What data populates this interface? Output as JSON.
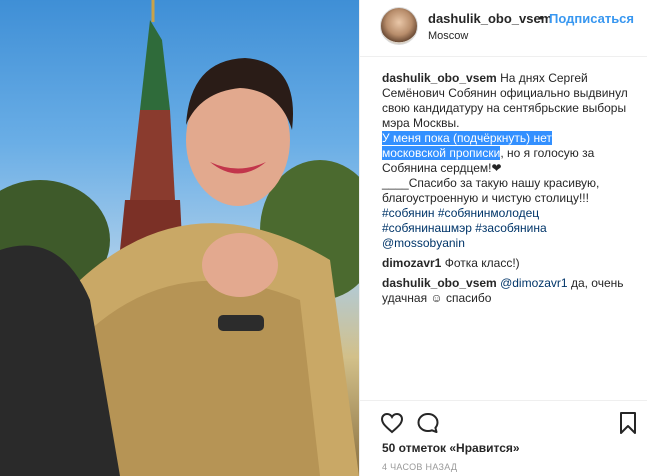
{
  "post": {
    "username": "dashulik_obo_vsem",
    "dot": "•",
    "follow_label": "Подписаться",
    "location": "Moscow"
  },
  "caption": {
    "author": "dashulik_obo_vsem",
    "l1": "На днях Сергей",
    "l2": "Семёнович Собянин официально выдвинул",
    "l3": "свою кандидатуру на сентябрьские выборы",
    "l4": "мэра Москвы.",
    "l5_highlight": "У меня пока (подчёркнуть) нет",
    "l6_highlight": "московской прописки",
    "l6_rest": ", но я голосую за",
    "l7": "Собянина сердцем!❤",
    "l8": "____Спасибо за такую нашу красивую,",
    "l9": "благоустроенную и чистую столицу!!!",
    "hashtags_1": "#собянин #собянинмолодец",
    "hashtags_2": "#собянинашмэр #засобянина",
    "mention": "@mossobyanin"
  },
  "comments": [
    {
      "user": "dimozavr1",
      "text": "Фотка класс!)"
    },
    {
      "user": "dashulik_obo_vsem",
      "mention": "@dimozavr1",
      "text_a": " да, очень",
      "text_b": "удачная ☺ спасибо"
    }
  ],
  "footer": {
    "likes": "50 отметок «Нравится»",
    "time": "4 ЧАСОВ НАЗАД"
  },
  "icons": [
    "heart-icon",
    "comment-icon",
    "bookmark-icon"
  ]
}
